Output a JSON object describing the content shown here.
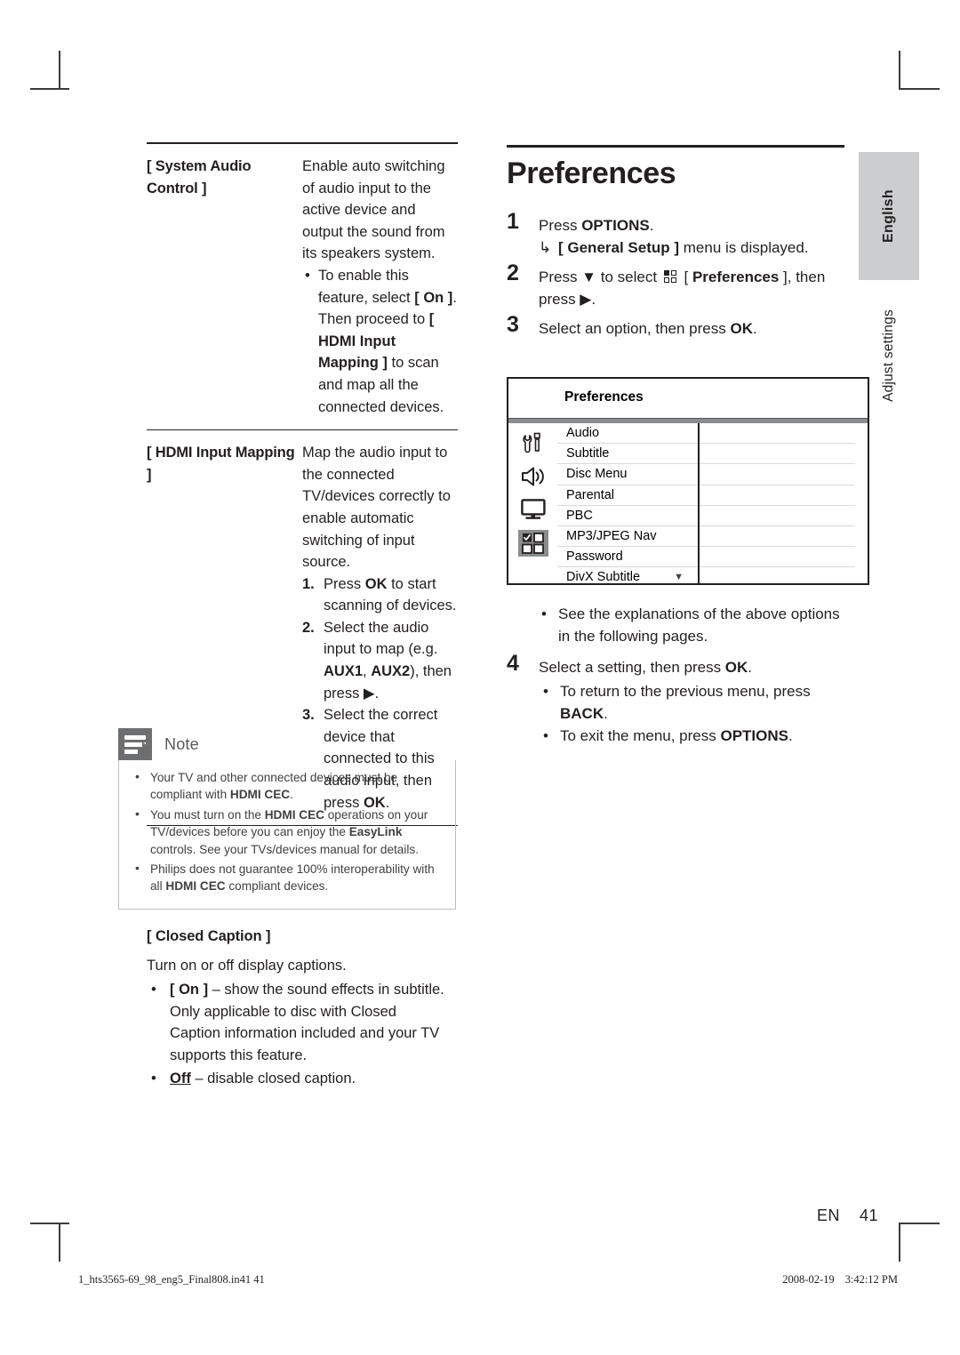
{
  "left_column": {
    "spec_table": [
      {
        "key": "[ System Audio Control ]",
        "paragraph": "Enable auto switching of audio input to the active device and output the sound from its speakers system.",
        "bullets": [
          "To enable this feature, select [ On ].  Then proceed to [ HDMI Input Mapping ] to scan and map all the connected devices."
        ]
      },
      {
        "key": "[ HDMI Input Mapping ]",
        "paragraph": "Map the audio input to the connected TV/devices correctly to enable automatic switching of input source.",
        "steps": [
          {
            "num": "1.",
            "text": "Press OK to start scanning of devices."
          },
          {
            "num": "2.",
            "text": "Select the audio input to map (e.g. AUX1, AUX2), then press ▶."
          },
          {
            "num": "3.",
            "text": "Select the correct device that connected to this audio input, then press OK."
          }
        ]
      }
    ],
    "note": {
      "title": "Note",
      "icon": "note-lines-icon",
      "bullets": [
        "Your TV and other connected devices must be compliant with HDMI CEC.",
        "You must turn on the HDMI CEC operations on your TV/devices before you can enjoy the EasyLink controls. See your TVs/devices manual for details.",
        "Philips does not guarantee 100% interoperability with all HDMI CEC compliant devices."
      ]
    },
    "closed_caption": {
      "title": "[ Closed Caption ]",
      "subtitle": "Turn on or off display captions.",
      "bullets": [
        "[ On ] – show the sound effects in subtitle. Only applicable to disc with Closed Caption information included and your TV supports this feature.",
        "[ Off ] – disable closed caption."
      ]
    }
  },
  "right_column": {
    "section_title": "Preferences",
    "steps": [
      {
        "num": "1",
        "text": "Press OPTIONS.",
        "sub_arrow": "[ General Setup ] menu is displayed."
      },
      {
        "num": "2",
        "text": "Press ▼ to select [ Preferences ], then press ▶.",
        "icon": "grid-2x2-icon"
      },
      {
        "num": "3",
        "text": "Select an option, then press OK."
      },
      {
        "num": "4",
        "text": "Select a setting, then press OK.",
        "bullets": [
          "To return to the previous menu, press BACK.",
          "To exit the menu, press OPTIONS."
        ]
      }
    ],
    "post_panel_bullets": [
      "See the explanations of the above options in the following pages."
    ]
  },
  "device_panel": {
    "header_title": "Preferences",
    "icons": [
      "tools-wrench-icon",
      "speaker-audio-icon",
      "tv-monitor-icon",
      "grid-preferences-icon"
    ],
    "active_icon_index": 3,
    "menu_items": [
      "Audio",
      "Subtitle",
      "Disc Menu",
      "Parental",
      "PBC",
      "MP3/JPEG Nav",
      "Password",
      "DivX Subtitle"
    ],
    "scroll_caret": "▼",
    "values": [
      "",
      "",
      "",
      "",
      "",
      "",
      "",
      ""
    ]
  },
  "side_tab": {
    "language_label": "English",
    "running_head": "Adjust settings"
  },
  "folio": {
    "language_code": "EN",
    "page_number": "41"
  },
  "printer_footer": {
    "filename": "1_hts3565-69_98_eng5_Final808.in41   41",
    "date": "2008-02-19",
    "time": "3:42:12 PM"
  },
  "colors": {
    "text": "#231f20",
    "note_icon_bg": "#6d6e70",
    "side_tab_bg": "#cccdce",
    "panel_band": "#8a8c8e",
    "menu_divider": "#d9dadb"
  }
}
